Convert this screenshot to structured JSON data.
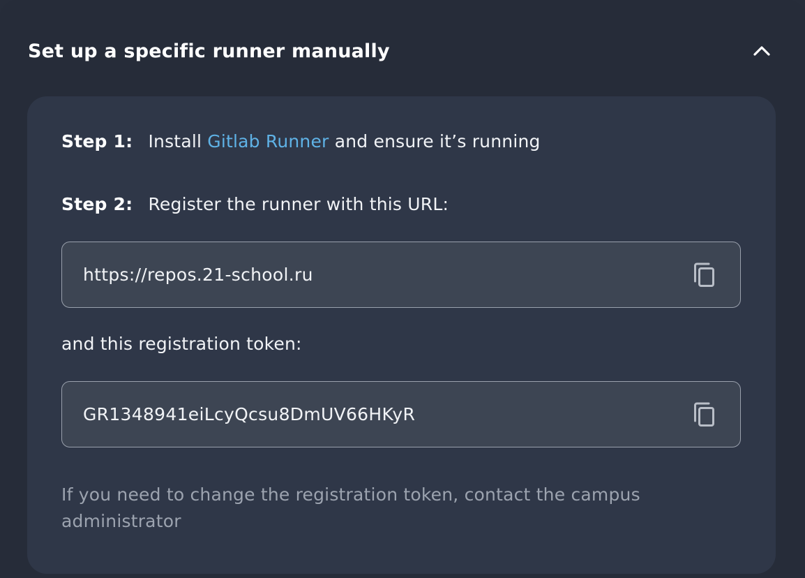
{
  "header": {
    "title": "Set up a specific runner manually",
    "toggle_icon": "chevron-up-icon"
  },
  "steps": {
    "step1": {
      "label": "Step 1:",
      "text_before": "Install",
      "link_text": "Gitlab Runner",
      "text_after": "and ensure it’s running"
    },
    "step2": {
      "label": "Step 2:",
      "text": "Register the runner with this URL:"
    }
  },
  "url_field": {
    "value": "https://repos.21-school.ru",
    "copy_icon": "copy-icon"
  },
  "token_label": "and this registration token:",
  "token_field": {
    "value": "GR1348941eiLcyQcsu8DmUV66HKyR",
    "copy_icon": "copy-icon"
  },
  "note": "If you need to change the registration token, contact the campus administrator",
  "colors": {
    "background": "#272d3a",
    "card": "#2f3748",
    "field": "#3d4553",
    "link": "#5fb2e6",
    "muted_text": "#9ca3af"
  }
}
